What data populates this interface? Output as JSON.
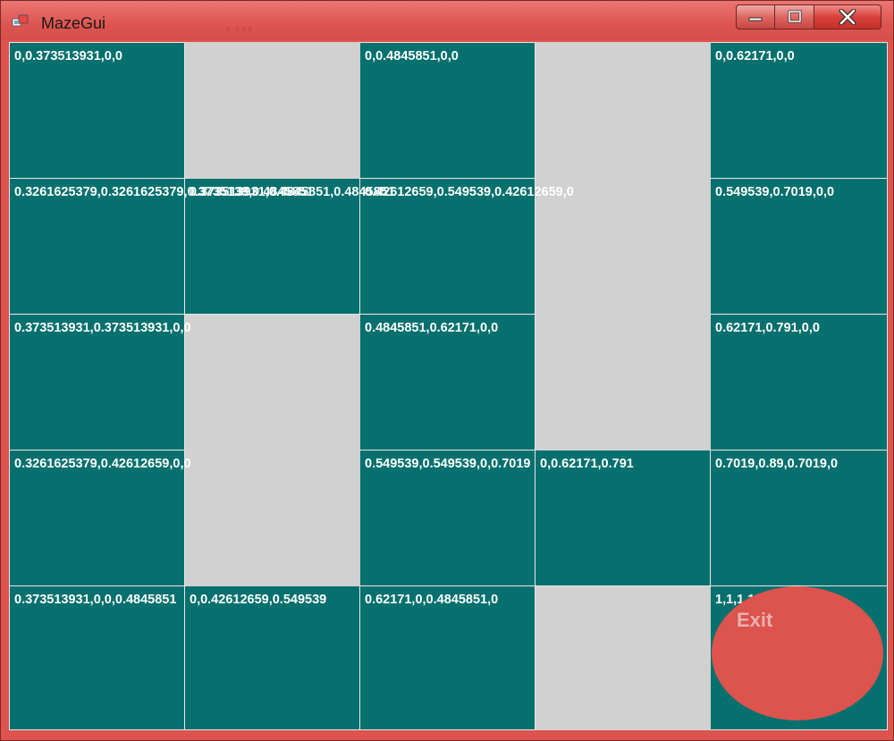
{
  "window": {
    "title": "MazeGui",
    "blurred_text": "● ●●●",
    "controls": {
      "minimize": "—",
      "maximize": "□",
      "close": "X"
    }
  },
  "colors": {
    "frame": "#dd534d",
    "tile": "#06706e",
    "empty": "#d1d1d1",
    "exit": "#dd534d"
  },
  "grid": {
    "rows": 5,
    "cols": 5,
    "cells": [
      {
        "label": "0,0.373513931,0,0",
        "type": "tile"
      },
      {
        "label": "",
        "type": "empty"
      },
      {
        "label": "0,0.4845851,0,0",
        "type": "tile"
      },
      {
        "label": "",
        "type": "empty"
      },
      {
        "label": "0,0.62171,0,0",
        "type": "tile"
      },
      {
        "label": "0.3261625379,0.3261625379,0.3735139,0.4845851",
        "type": "tile"
      },
      {
        "label": "0.373513931,0.4845851,0.4845851",
        "type": "tile"
      },
      {
        "label": "0.42612659,0.549539,0.42612659,0",
        "type": "tile"
      },
      {
        "label": "",
        "type": "empty"
      },
      {
        "label": "0.549539,0.7019,0,0",
        "type": "tile"
      },
      {
        "label": "0.373513931,0.373513931,0,0",
        "type": "tile"
      },
      {
        "label": "",
        "type": "empty"
      },
      {
        "label": "0.4845851,0.62171,0,0",
        "type": "tile"
      },
      {
        "label": "",
        "type": "empty"
      },
      {
        "label": "0.62171,0.791,0,0",
        "type": "tile"
      },
      {
        "label": "0.3261625379,0.42612659,0,0",
        "type": "tile"
      },
      {
        "label": "",
        "type": "empty"
      },
      {
        "label": "0.549539,0.549539,0,0.7019",
        "type": "tile"
      },
      {
        "label": "0,0.62171,0.791",
        "type": "tile"
      },
      {
        "label": "0.7019,0.89,0.7019,0",
        "type": "tile"
      },
      {
        "label": "0.373513931,0,0,0.4845851",
        "type": "tile"
      },
      {
        "label": "0,0.42612659,0.549539",
        "type": "tile"
      },
      {
        "label": "0.62171,0,0.4845851,0",
        "type": "tile"
      },
      {
        "label": "",
        "type": "empty"
      },
      {
        "label": "1,1,1,1",
        "type": "tile"
      }
    ]
  },
  "exit_button": {
    "label": "Exit"
  }
}
